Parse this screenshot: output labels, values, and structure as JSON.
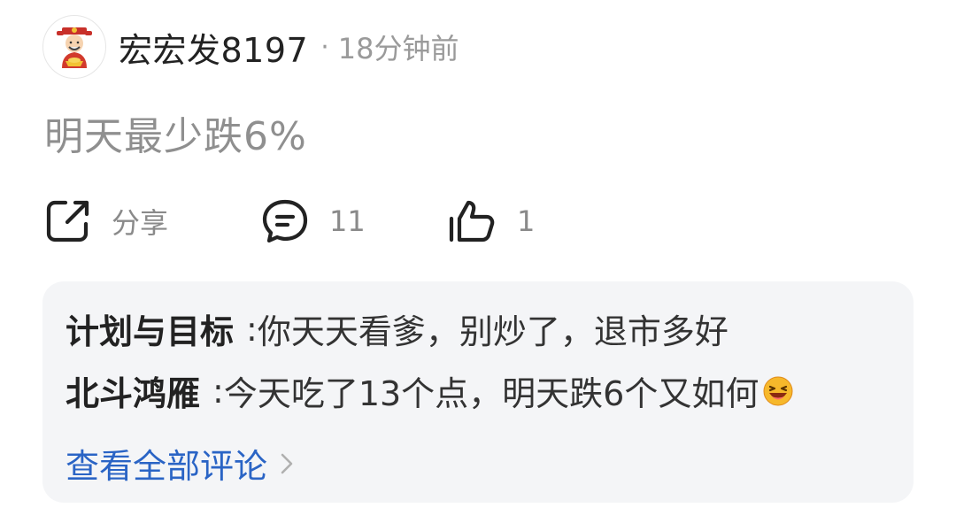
{
  "post": {
    "username": "宏宏发8197",
    "separator": "·",
    "time": "18分钟前",
    "avatar_icon": "god-of-wealth-avatar-icon",
    "text": "明天最少跌6%"
  },
  "actions": {
    "share": {
      "icon": "share-icon",
      "label": "分享"
    },
    "comment": {
      "icon": "comment-bubble-icon",
      "count": "11"
    },
    "like": {
      "icon": "thumbs-up-icon",
      "count": "1"
    }
  },
  "comments": [
    {
      "author": "计划与目标",
      "separator": ":",
      "text": "你天天看爹，别炒了，退市多好"
    },
    {
      "author": "北斗鸿雁",
      "separator": ":",
      "text": "今天吃了13个点，明天跌6个又如何",
      "emoji": "laughing-emoji-icon"
    }
  ],
  "view_all": {
    "label": "查看全部评论",
    "icon": "chevron-right-icon"
  },
  "colors": {
    "link": "#2a64c5",
    "card_bg": "#f4f5f7",
    "muted_text": "#8f8f8f"
  }
}
